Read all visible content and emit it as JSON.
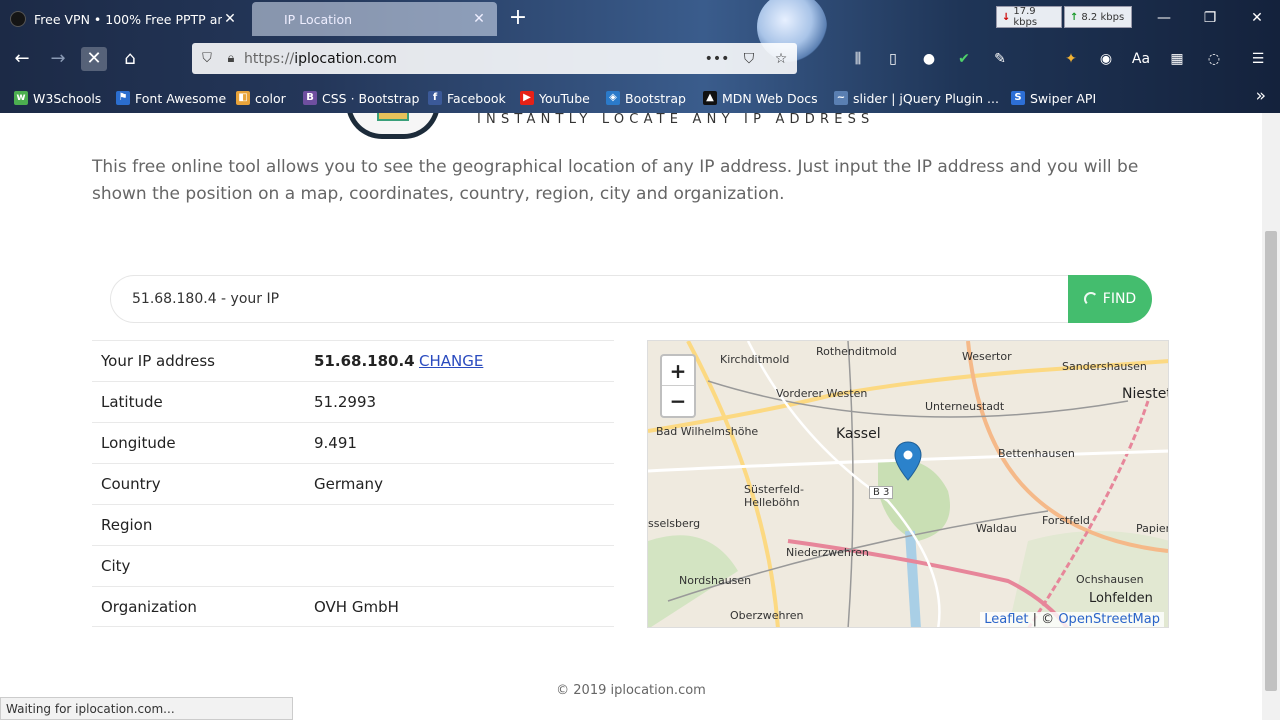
{
  "tabs": [
    {
      "title": "Free VPN • 100% Free PPTP an",
      "active": false
    },
    {
      "title": "IP Location",
      "active": true
    }
  ],
  "network": {
    "download": "17.9 kbps",
    "upload": "8.2 kbps"
  },
  "urlbar": {
    "url_scheme": "https://",
    "url_host": "iplocation.com"
  },
  "bookmarks": [
    {
      "label": "W3Schools",
      "color": "#4caf50"
    },
    {
      "label": "Font Awesome",
      "color": "#2b6ecf"
    },
    {
      "label": "color",
      "color": "#e8a33a"
    },
    {
      "label": "CSS · Bootstrap",
      "color": "#6f4fa0"
    },
    {
      "label": "Facebook",
      "color": "#3b5998"
    },
    {
      "label": "YouTube",
      "color": "#e62117"
    },
    {
      "label": "Bootstrap",
      "color": "#2b7ac9"
    },
    {
      "label": "MDN Web Docs",
      "color": "#111111"
    },
    {
      "label": "slider | jQuery Plugin ...",
      "color": "#5a7fb2"
    },
    {
      "label": "Swiper API",
      "color": "#2d6fd6"
    }
  ],
  "header": {
    "tagline": "INSTANTLY LOCATE ANY IP ADDRESS"
  },
  "intro": "This free online tool allows you to see the geographical location of any IP address. Just input the IP address and you will be shown the position on a map, coordinates, country, region, city and organization.",
  "search": {
    "value": "51.68.180.4 - your IP",
    "button": "FIND"
  },
  "results": [
    {
      "key": "Your IP address",
      "value": "51.68.180.4",
      "action": "CHANGE"
    },
    {
      "key": "Latitude",
      "value": "51.2993"
    },
    {
      "key": "Longitude",
      "value": "9.491"
    },
    {
      "key": "Country",
      "value": "Germany"
    },
    {
      "key": "Region",
      "value": ""
    },
    {
      "key": "City",
      "value": ""
    },
    {
      "key": "Organization",
      "value": "OVH GmbH"
    }
  ],
  "map": {
    "zoom_in": "+",
    "zoom_out": "−",
    "labels": [
      "Kirchditmold",
      "Rothenditmold",
      "Wesertor",
      "Sandershausen",
      "Vorderer Westen",
      "Unterneustadt",
      "Niestet",
      "Bad Wilhelmshöhe",
      "Kassel",
      "Bettenhausen",
      "Süsterfeld-Helleböhn",
      "B 3",
      "Waldau",
      "Forstfeld",
      "Papierfa",
      "sselsberg",
      "Niederzwehren",
      "Nordshausen",
      "Ochshausen",
      "Lohfelden",
      "Oberzwehren"
    ],
    "attribution_leaflet": "Leaflet",
    "attribution_sep": "| ©",
    "attribution_osm": "OpenStreetMap"
  },
  "footer": "© 2019 iplocation.com",
  "status": "Waiting for iplocation.com..."
}
